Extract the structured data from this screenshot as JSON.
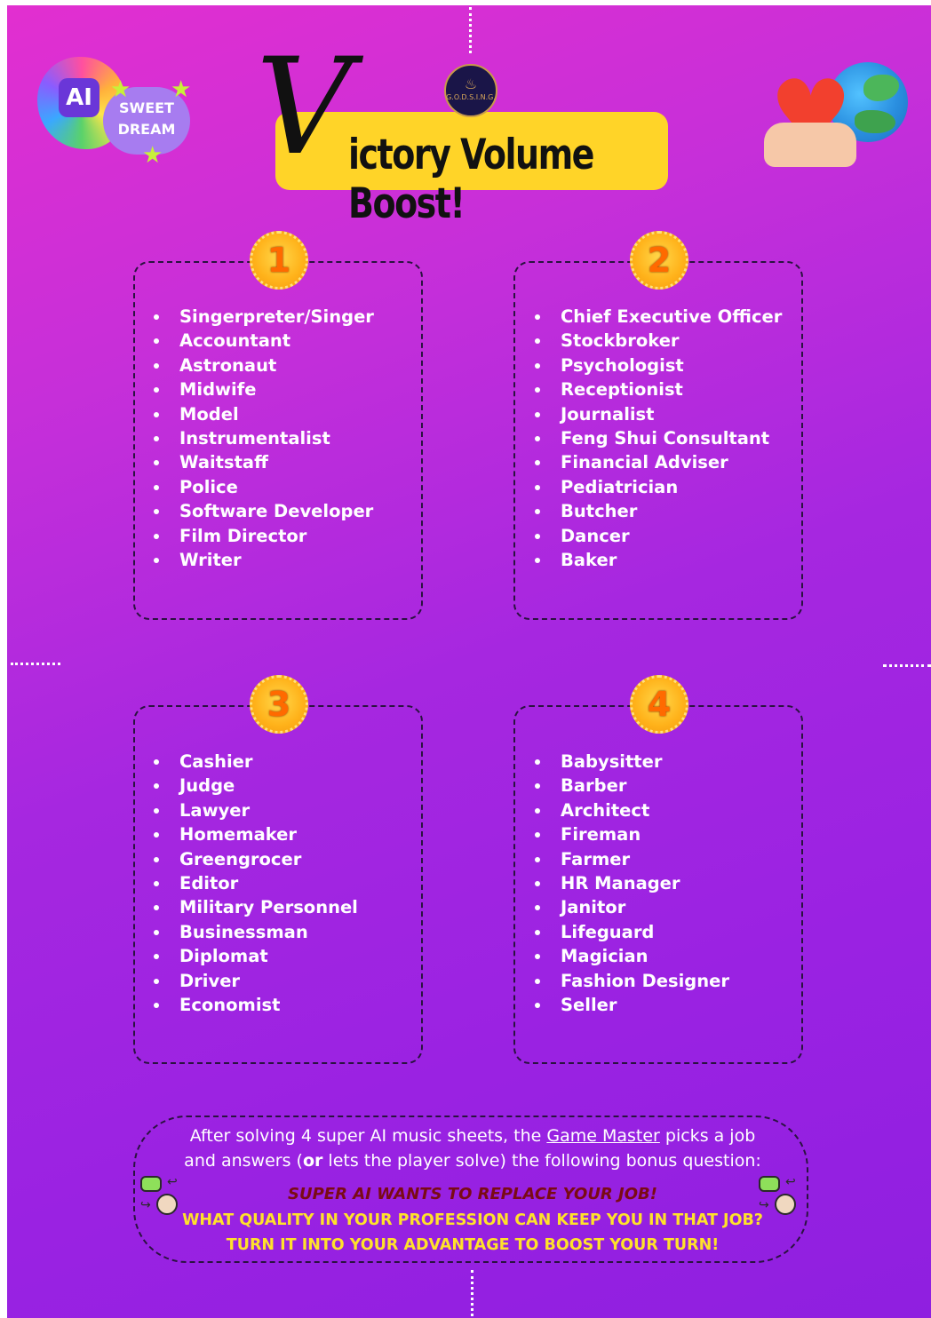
{
  "header": {
    "title_initial": "V",
    "title_rest": "ictory Volume Boost!",
    "logo_text": "G.O.D.S.I.N.G."
  },
  "ai_badge": {
    "chip": "AI",
    "line1": "SWEET",
    "line2": "DREAM"
  },
  "groups": [
    {
      "number": "1",
      "jobs": [
        "Singerpreter/Singer",
        "Accountant",
        "Astronaut",
        "Midwife",
        "Model",
        "Instrumentalist",
        "Waitstaff",
        "Police",
        "Software Developer",
        "Film Director",
        "Writer"
      ]
    },
    {
      "number": "2",
      "jobs": [
        "Chief Executive Officer",
        "Stockbroker",
        "Psychologist",
        "Receptionist",
        "Journalist",
        "Feng Shui Consultant",
        "Financial Adviser",
        "Pediatrician",
        "Butcher",
        "Dancer",
        "Baker"
      ]
    },
    {
      "number": "3",
      "jobs": [
        "Cashier",
        "Judge",
        "Lawyer",
        "Homemaker",
        "Greengrocer",
        "Editor",
        "Military Personnel",
        "Businessman",
        "Diplomat",
        "Driver",
        "Economist"
      ]
    },
    {
      "number": "4",
      "jobs": [
        "Babysitter",
        "Barber",
        "Architect",
        "Fireman",
        "Farmer",
        "HR Manager",
        "Janitor",
        "Lifeguard",
        "Magician",
        "Fashion Designer",
        "Seller"
      ]
    }
  ],
  "note": {
    "line1_a": "After solving 4 super AI music sheets, the ",
    "line1_link": "Game Master",
    "line1_b": " picks a job",
    "line2_a": "and answers (",
    "line2_bold": "or",
    "line2_b": " lets the player solve) the following bonus question:",
    "line3": "SUPER AI WANTS TO REPLACE YOUR JOB!",
    "line4": "WHAT QUALITY IN YOUR PROFESSION CAN KEEP YOU IN THAT JOB?",
    "line5": "TURN IT INTO YOUR ADVANTAGE TO BOOST YOUR TURN!"
  },
  "colors": {
    "background_top": "#e22fd0",
    "background_bottom": "#8f1fe0",
    "title_bar": "#ffd428",
    "badge": "#ffb21a",
    "question_red": "#7a0a14",
    "question_yellow": "#ffe22a"
  },
  "icons": [
    "ai-sweet-dream-icon",
    "heart-globe-icon",
    "gods-logo-icon",
    "robot-swap-icon"
  ]
}
